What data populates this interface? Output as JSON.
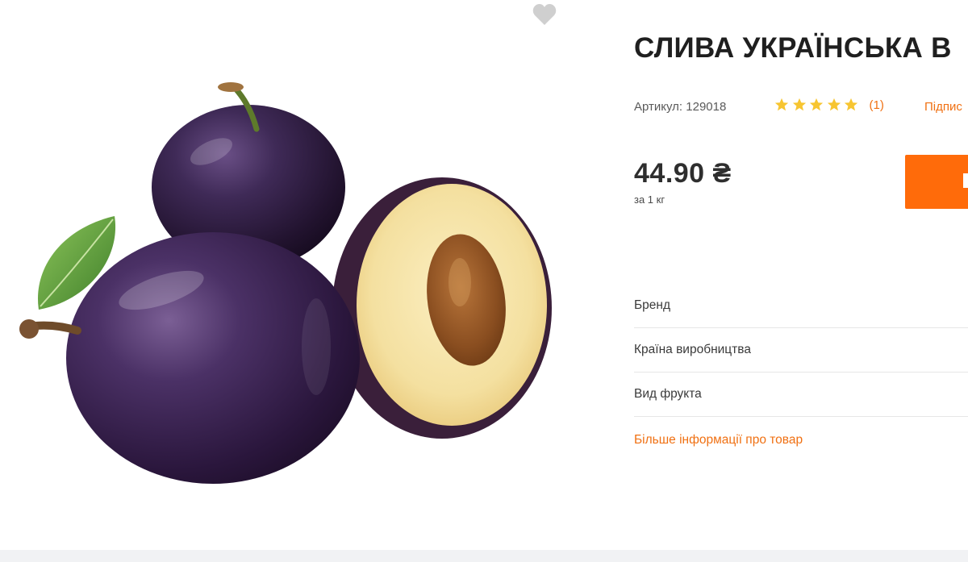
{
  "product": {
    "title": "СЛИВА УКРАЇНСЬКА В",
    "sku": "Артикул: 129018",
    "rating": {
      "stars": 5,
      "count": "(1)"
    },
    "subscribe_label": "Підпис",
    "price": "44.90 ₴",
    "price_unit": "за 1 кг",
    "image": {
      "alt": "plums"
    },
    "attributes": [
      {
        "label": "Бренд"
      },
      {
        "label": "Країна виробництва"
      },
      {
        "label": "Вид фрукта"
      }
    ],
    "more_info_label": "Більше інформації про товар"
  },
  "colors": {
    "accent": "#ff6b0a",
    "link": "#f07012",
    "star": "#f7c531",
    "favorite_icon": "#cfcfcf"
  },
  "icons": {
    "favorite": "heart-icon",
    "star": "star-icon"
  }
}
